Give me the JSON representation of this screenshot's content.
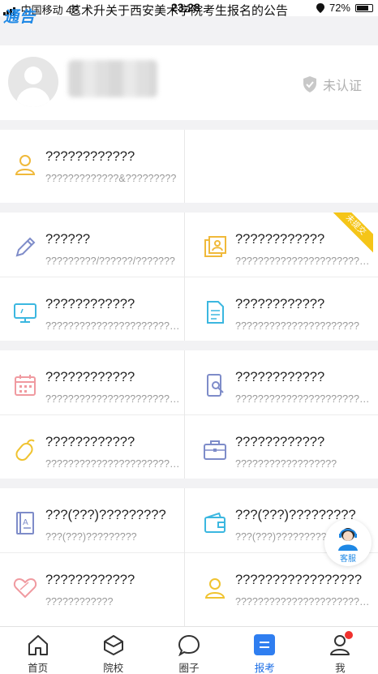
{
  "status_bar": {
    "logo": "通告",
    "carrier": "中国移动 4G",
    "ticker": "艺术升关于西安美术学院考生报名的公告",
    "time": "23:28",
    "battery": "72%"
  },
  "profile": {
    "verify_label": "未认证"
  },
  "grid": [
    {
      "title": "????????????",
      "sub": "?????????????&?????????",
      "icon": "person-icon",
      "color": "#f0b93a"
    },
    {
      "title": "",
      "sub": "",
      "icon": "",
      "color": ""
    },
    {
      "title": "??????",
      "sub": "?????????/??????/???????",
      "icon": "pencil-icon",
      "color": "#7e8cc9"
    },
    {
      "title": "????????????",
      "sub": "????????????????????????????",
      "icon": "photo-card-icon",
      "color": "#f0b93a",
      "ribbon": "未提交"
    },
    {
      "title": "????????????",
      "sub": "?????????????????????????",
      "icon": "monitor-icon",
      "color": "#3bb7e0"
    },
    {
      "title": "????????????",
      "sub": "??????????????????????",
      "icon": "document-icon",
      "color": "#3bb7e0"
    },
    {
      "title": "????????????",
      "sub": "??????????????????????????",
      "icon": "calendar-icon",
      "color": "#f09aa0"
    },
    {
      "title": "????????????",
      "sub": "????????????????????????????",
      "icon": "phone-search-icon",
      "color": "#7e8cc9"
    },
    {
      "title": "????????????",
      "sub": "??????????????????????????",
      "icon": "mouse-icon",
      "color": "#f0c330"
    },
    {
      "title": "????????????",
      "sub": "??????????????????",
      "icon": "briefcase-icon",
      "color": "#7e8cc9"
    },
    {
      "title": "???(???)?????????",
      "sub": "???(???)?????????",
      "icon": "notebook-icon",
      "color": "#7e8cc9"
    },
    {
      "title": "???(???)?????????",
      "sub": "???(???)?????????",
      "icon": "wallet-icon",
      "color": "#3bb7e0"
    },
    {
      "title": "????????????",
      "sub": "????????????",
      "icon": "heart-icon",
      "color": "#f09aa0"
    },
    {
      "title": "?????????????????",
      "sub": "????????????????????????????",
      "icon": "person-icon",
      "color": "#f0c330"
    }
  ],
  "service_label": "客服",
  "tabs": [
    {
      "label": "首页",
      "icon": "home-icon"
    },
    {
      "label": "院校",
      "icon": "school-icon"
    },
    {
      "label": "圈子",
      "icon": "chat-bubble-icon"
    },
    {
      "label": "报考",
      "icon": "register-icon",
      "active": true
    },
    {
      "label": "我",
      "icon": "profile-icon",
      "badge": true
    }
  ]
}
